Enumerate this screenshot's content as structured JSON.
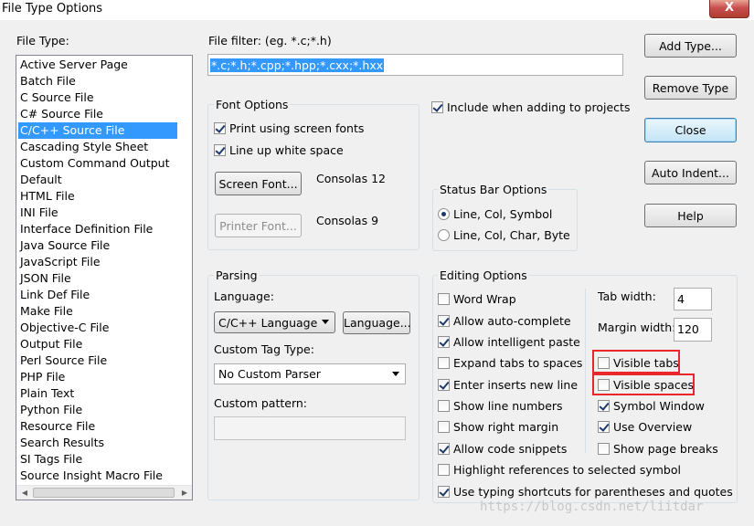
{
  "window": {
    "title": "File Type Options",
    "close_symbol": "X"
  },
  "file_type": {
    "label": "File Type:",
    "items": [
      "Active Server Page",
      "Batch File",
      "C Source File",
      "C# Source File",
      "C/C++ Source File",
      "Cascading Style Sheet",
      "Custom Command Output",
      "Default",
      "HTML File",
      "INI File",
      "Interface Definition File",
      "Java Source File",
      "JavaScript File",
      "JSON File",
      "Link Def File",
      "Make File",
      "Objective-C File",
      "Output File",
      "Perl Source File",
      "PHP File",
      "Plain Text",
      "Python File",
      "Resource File",
      "Search Results",
      "SI Tags File",
      "Source Insight Macro File"
    ],
    "selected_index": 4
  },
  "file_filter": {
    "label": "File filter: (eg. *.c;*.h)",
    "value": "*.c;*.h;*.cpp;*.hpp;*.cxx;*.hxx"
  },
  "font_options": {
    "title": "Font Options",
    "print_screen_fonts": {
      "label": "Print using screen fonts",
      "checked": true
    },
    "line_up_white_space": {
      "label": "Line up white space",
      "checked": true
    },
    "screen_font_button": "Screen Font...",
    "screen_font_value": "Consolas 12",
    "printer_font_button": "Printer Font...",
    "printer_font_value": "Consolas 9"
  },
  "include_projects": {
    "label": "Include when adding to projects",
    "checked": true
  },
  "status_bar": {
    "title": "Status Bar Options",
    "option1": {
      "label": "Line, Col, Symbol",
      "checked": true
    },
    "option2": {
      "label": "Line, Col, Char, Byte",
      "checked": false
    }
  },
  "parsing": {
    "title": "Parsing",
    "language_label": "Language:",
    "language_value": "C/C++ Language",
    "language_button": "Language...",
    "custom_tag_label": "Custom Tag Type:",
    "custom_tag_value": "No Custom Parser",
    "custom_pattern_label": "Custom pattern:",
    "custom_pattern_value": ""
  },
  "editing": {
    "title": "Editing Options",
    "left": [
      {
        "label": "Word Wrap",
        "checked": false
      },
      {
        "label": "Allow auto-complete",
        "checked": true
      },
      {
        "label": "Allow intelligent paste",
        "checked": true
      },
      {
        "label": "Expand tabs to spaces",
        "checked": false
      },
      {
        "label": "Enter inserts new line",
        "checked": true
      },
      {
        "label": "Show line numbers",
        "checked": false
      },
      {
        "label": "Show right margin",
        "checked": false
      },
      {
        "label": "Allow code snippets",
        "checked": true
      }
    ],
    "tab_width_label": "Tab width:",
    "tab_width_value": "4",
    "margin_width_label": "Margin width:",
    "margin_width_value": "120",
    "right": [
      {
        "label": "Visible tabs",
        "checked": false
      },
      {
        "label": "Visible spaces",
        "checked": false
      },
      {
        "label": "Symbol Window",
        "checked": true
      },
      {
        "label": "Use Overview",
        "checked": true
      },
      {
        "label": "Show page breaks",
        "checked": false
      }
    ],
    "highlight_refs": {
      "label": "Highlight references to selected symbol",
      "checked": false
    },
    "typing_shortcuts": {
      "label": "Use typing shortcuts for parentheses and quotes",
      "checked": true
    }
  },
  "buttons": {
    "add_type": "Add Type...",
    "remove_type": "Remove Type",
    "close": "Close",
    "auto_indent": "Auto Indent...",
    "help": "Help"
  },
  "watermark": "https://blog.csdn.net/liitdar",
  "colors": {
    "selection": "#3399ff",
    "highlight_box": "#e8262b"
  }
}
